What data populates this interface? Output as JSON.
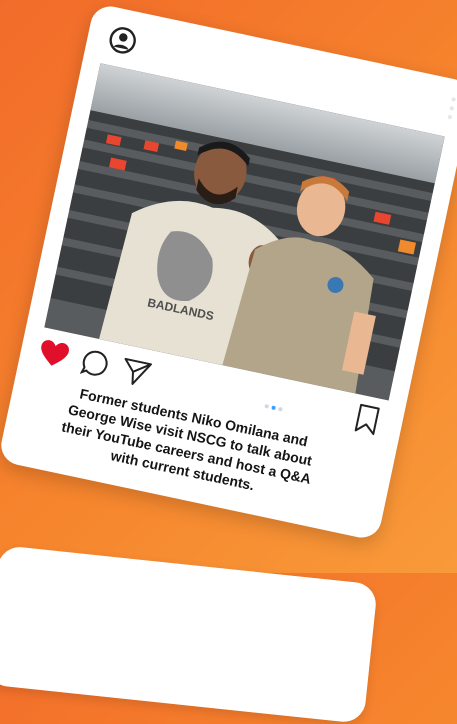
{
  "post": {
    "caption": "Former students Niko Omilana and\nGeorge Wise visit NSCG to talk about\ntheir YouTube careers and host a Q&A\nwith current students.",
    "photo_text": "BADLANDS",
    "liked": true,
    "carousel": {
      "count": 3,
      "active_index": 1
    }
  },
  "icons": {
    "profile": "user-circle-icon",
    "more": "vertical-dots-icon",
    "like": "heart-icon",
    "comment": "speech-bubble-icon",
    "share": "paper-plane-icon",
    "save": "bookmark-icon"
  },
  "colors": {
    "background": "#f47a2c",
    "card": "#ffffff",
    "like": "#e0102b",
    "caption": "#151515",
    "active_dot": "#3aa0ff"
  }
}
